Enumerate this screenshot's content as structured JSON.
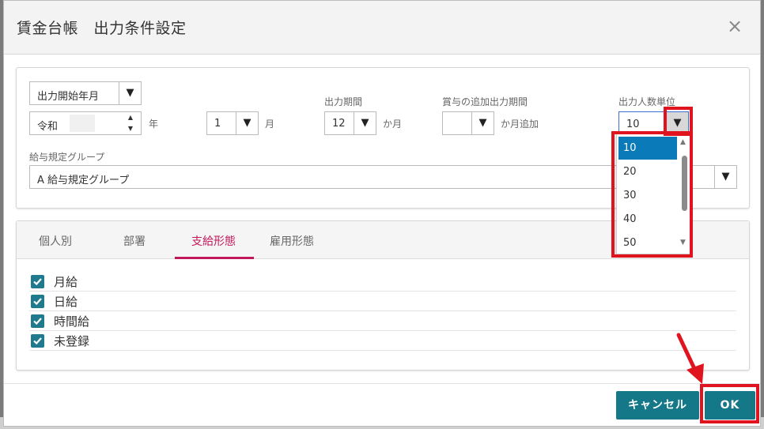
{
  "dialog": {
    "title": "賃金台帳　出力条件設定",
    "close_icon": "×"
  },
  "conditions": {
    "start_type": {
      "value": "出力開始年月"
    },
    "era": {
      "value": "令和",
      "unit_year": "年"
    },
    "month": {
      "value": "1",
      "unit": "月"
    },
    "period": {
      "label": "出力期間",
      "value": "12",
      "unit": "か月"
    },
    "bonus_period": {
      "label": "賞与の追加出力期間",
      "value": "",
      "unit": "か月追加"
    },
    "people_unit": {
      "label": "出力人数単位",
      "value": "10",
      "options": [
        "10",
        "20",
        "30",
        "40",
        "50"
      ],
      "selected_index": 0
    },
    "rule_group": {
      "label": "給与規定グループ",
      "value": "A 給与規定グループ"
    }
  },
  "tabs": [
    {
      "label": "個人別"
    },
    {
      "label": "部署"
    },
    {
      "label": "支給形態"
    },
    {
      "label": "雇用形態"
    }
  ],
  "active_tab": 2,
  "checkboxes": [
    {
      "label": "月給",
      "checked": true
    },
    {
      "label": "日給",
      "checked": true
    },
    {
      "label": "時間給",
      "checked": true
    },
    {
      "label": "未登録",
      "checked": true
    }
  ],
  "footer": {
    "cancel_label": "キャンセル",
    "ok_label": "OK"
  },
  "icons": {
    "dropdown_arrow": "▼",
    "spin_up": "▲",
    "spin_down": "▼"
  },
  "colors": {
    "accent": "#157889",
    "tab_active": "#c2185b",
    "highlight": "#e0141e",
    "dropdown_selected": "#0a7ab8"
  }
}
